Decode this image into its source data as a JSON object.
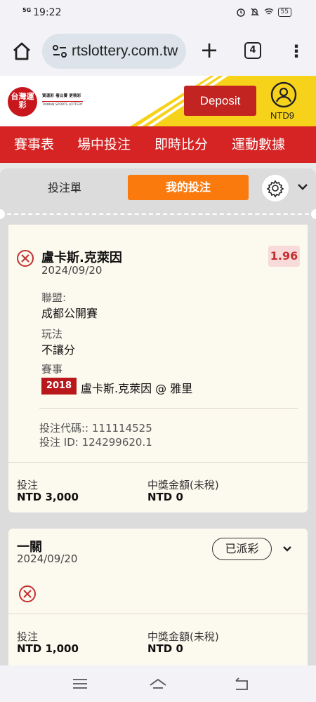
{
  "status_bar": {
    "network": "5G",
    "time": "19:22",
    "icons": [
      "alarm-icon",
      "mute-icon",
      "wifi-icon"
    ],
    "battery": "55"
  },
  "browser": {
    "url": "rtslottery.com.tw",
    "tab_count": "4",
    "plus": "+",
    "menu": "⋮"
  },
  "site_header": {
    "logo_main": "台灣運彩",
    "logo_line": "賀運彩  看比賽  更精彩",
    "logo_sub": "TAIWAN SPORTS LOTTERY",
    "deposit_label": "Deposit",
    "balance": "NTD9"
  },
  "nav": {
    "items": [
      "賽事表",
      "場中投注",
      "即時比分",
      "運動數據"
    ]
  },
  "bet_panel": {
    "tab_slip": "投注單",
    "tab_mybets": "我的投注"
  },
  "bet1": {
    "selection": "盧卡斯.克萊因",
    "date": "2024/09/20",
    "odds": "1.96",
    "league_label": "聯盟:",
    "league_value": "成都公開賽",
    "market_label": "玩法",
    "market_value": "不讓分",
    "event_label": "賽事",
    "event_year": "2018",
    "event_name": "盧卡斯.克萊因 @ 雅里",
    "bet_code": "投注代碼:: 111114525",
    "bet_id": "投注 ID: 124299620.1",
    "stake_label": "投注",
    "stake_value": "NTD 3,000",
    "payout_label": "中獎金額(未稅)",
    "payout_value": "NTD 0"
  },
  "bet2": {
    "title": "一關",
    "date": "2024/09/20",
    "status": "已派彩",
    "stake_label": "投注",
    "stake_value": "NTD 1,000",
    "payout_label": "中獎金額(未稅)",
    "payout_value": "NTD 0"
  },
  "colors": {
    "brand_red": "#d62424",
    "accent_orange": "#fb7a0d",
    "loss_red": "#c23030",
    "yellow": "#f7d21b"
  }
}
